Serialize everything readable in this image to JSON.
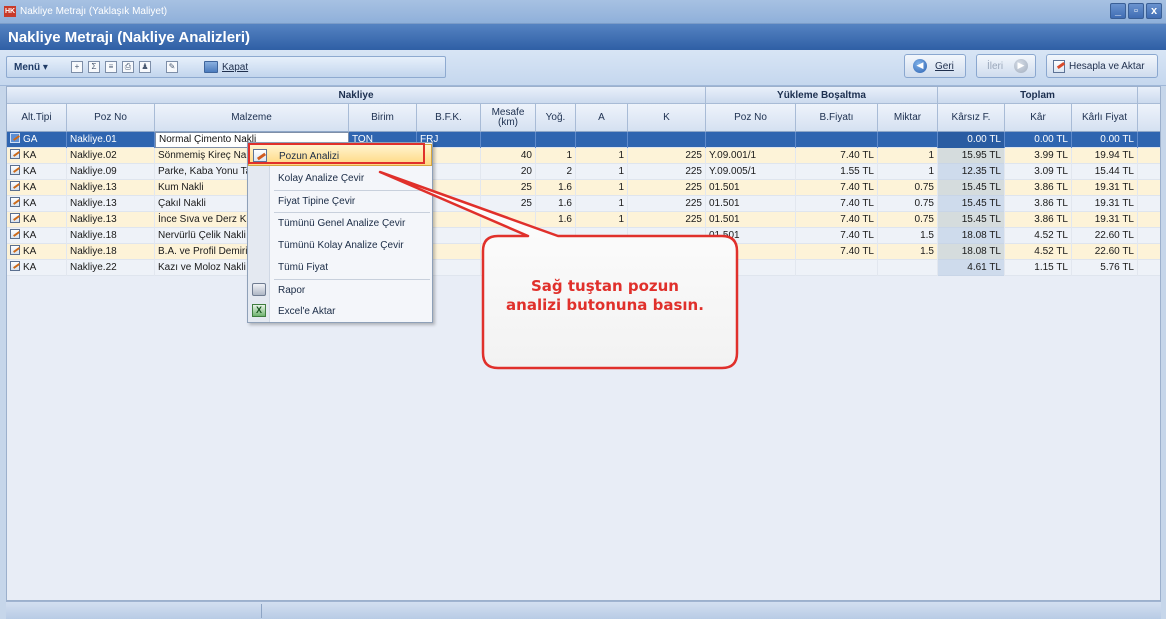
{
  "window": {
    "title": "Nakliye Metrajı (Yaklaşık Maliyet)",
    "app_icon": "HK"
  },
  "header": {
    "title": "Nakliye Metrajı (Nakliye Analizleri)"
  },
  "toolbar": {
    "menu_label": "Menü",
    "kapat_label": "Kapat"
  },
  "actions": {
    "back_label": "Geri",
    "forward_label": "İleri",
    "calc_label": "Hesapla ve Aktar"
  },
  "bands": {
    "nakliye": "Nakliye",
    "yukleme": "Yükleme Boşaltma",
    "toplam": "Toplam"
  },
  "columns": [
    "Alt.Tipi",
    "Poz No",
    "Malzeme",
    "Birim",
    "B.F.K.",
    "Mesafe (km)",
    "Yoğ.",
    "A",
    "K",
    "Poz No",
    "B.Fiyatı",
    "Miktar",
    "Kârsız F.",
    "Kâr",
    "Kârlı Fiyat"
  ],
  "rows": [
    {
      "tip": "GA",
      "poz": "Nakliye.01",
      "malzeme": "Normal Çimento Nakli",
      "birim": "TON",
      "bfk": "FRJ",
      "mesafe": "",
      "yog": "",
      "a": "",
      "k": "",
      "ypoz": "",
      "bfiyat": "",
      "miktar": "",
      "karsiz": "0.00 TL",
      "kar": "0.00 TL",
      "karli": "0.00 TL"
    },
    {
      "tip": "KA",
      "poz": "Nakliye.02",
      "malzeme": "Sönmemiş Kireç Na",
      "birim": "",
      "bfk": "U",
      "mesafe": "40",
      "yog": "1",
      "a": "1",
      "k": "225",
      "ypoz": "Y.09.001/1",
      "bfiyat": "7.40 TL",
      "miktar": "1",
      "karsiz": "15.95 TL",
      "kar": "3.99 TL",
      "karli": "19.94 TL"
    },
    {
      "tip": "KA",
      "poz": "Nakliye.09",
      "malzeme": "Parke, Kaba Yonu Ta",
      "birim": "",
      "bfk": "U",
      "mesafe": "20",
      "yog": "2",
      "a": "1",
      "k": "225",
      "ypoz": "Y.09.005/1",
      "bfiyat": "1.55 TL",
      "miktar": "1",
      "karsiz": "12.35 TL",
      "kar": "3.09 TL",
      "karli": "15.44 TL"
    },
    {
      "tip": "KA",
      "poz": "Nakliye.13",
      "malzeme": "Kum Nakli",
      "birim": "",
      "bfk": "U",
      "mesafe": "25",
      "yog": "1.6",
      "a": "1",
      "k": "225",
      "ypoz": "01.501",
      "bfiyat": "7.40 TL",
      "miktar": "0.75",
      "karsiz": "15.45 TL",
      "kar": "3.86 TL",
      "karli": "19.31 TL"
    },
    {
      "tip": "KA",
      "poz": "Nakliye.13",
      "malzeme": "Çakıl Nakli",
      "birim": "",
      "bfk": "U",
      "mesafe": "25",
      "yog": "1.6",
      "a": "1",
      "k": "225",
      "ypoz": "01.501",
      "bfiyat": "7.40 TL",
      "miktar": "0.75",
      "karsiz": "15.45 TL",
      "kar": "3.86 TL",
      "karli": "19.31 TL"
    },
    {
      "tip": "KA",
      "poz": "Nakliye.13",
      "malzeme": "İnce Sıva ve Derz Ku",
      "birim": "",
      "bfk": "U",
      "mesafe": "",
      "yog": "1.6",
      "a": "1",
      "k": "225",
      "ypoz": "01.501",
      "bfiyat": "7.40 TL",
      "miktar": "0.75",
      "karsiz": "15.45 TL",
      "kar": "3.86 TL",
      "karli": "19.31 TL"
    },
    {
      "tip": "KA",
      "poz": "Nakliye.18",
      "malzeme": "Nervürlü Çelik Nakli",
      "birim": "",
      "bfk": "U",
      "mesafe": "",
      "yog": "",
      "a": "",
      "k": "",
      "ypoz": "01.501",
      "bfiyat": "7.40 TL",
      "miktar": "1.5",
      "karsiz": "18.08 TL",
      "kar": "4.52 TL",
      "karli": "22.60 TL"
    },
    {
      "tip": "KA",
      "poz": "Nakliye.18",
      "malzeme": "B.A. ve Profil Demiri",
      "birim": "",
      "bfk": "AY",
      "mesafe": "",
      "yog": "",
      "a": "",
      "k": "",
      "ypoz": ".501",
      "bfiyat": "7.40 TL",
      "miktar": "1.5",
      "karsiz": "18.08 TL",
      "kar": "4.52 TL",
      "karli": "22.60 TL"
    },
    {
      "tip": "KA",
      "poz": "Nakliye.22",
      "malzeme": "Kazı ve Moloz Nakli",
      "birim": "",
      "bfk": "U",
      "mesafe": "",
      "yog": "",
      "a": "",
      "k": "",
      "ypoz": "",
      "bfiyat": "",
      "miktar": "",
      "karsiz": "4.61 TL",
      "kar": "1.15 TL",
      "karli": "5.76 TL"
    }
  ],
  "context_menu": {
    "items": [
      "Pozun Analizi",
      "Kolay Analize Çevir",
      "Fiyat Tipine Çevir",
      "Tümünü Genel Analize Çevir",
      "Tümünü Kolay Analize Çevir",
      "Tümü Fiyat",
      "Rapor",
      "Excel'e Aktar"
    ],
    "highlighted": "Pozun Analizi"
  },
  "callout": {
    "line1": "Sağ tuştan pozun",
    "line2": "analizi butonuna basın.",
    "color": "#e0302b"
  },
  "colors": {
    "header_blue": "#2f5fa5",
    "selected_row": "#2f65b0",
    "row_even": "#fdf3d8",
    "annotation_red": "#e0302b"
  },
  "icons": {
    "back": "arrow-left-circle-icon",
    "forward": "arrow-right-circle-icon",
    "calc": "edit-calc-icon",
    "row": "edit-row-icon"
  }
}
